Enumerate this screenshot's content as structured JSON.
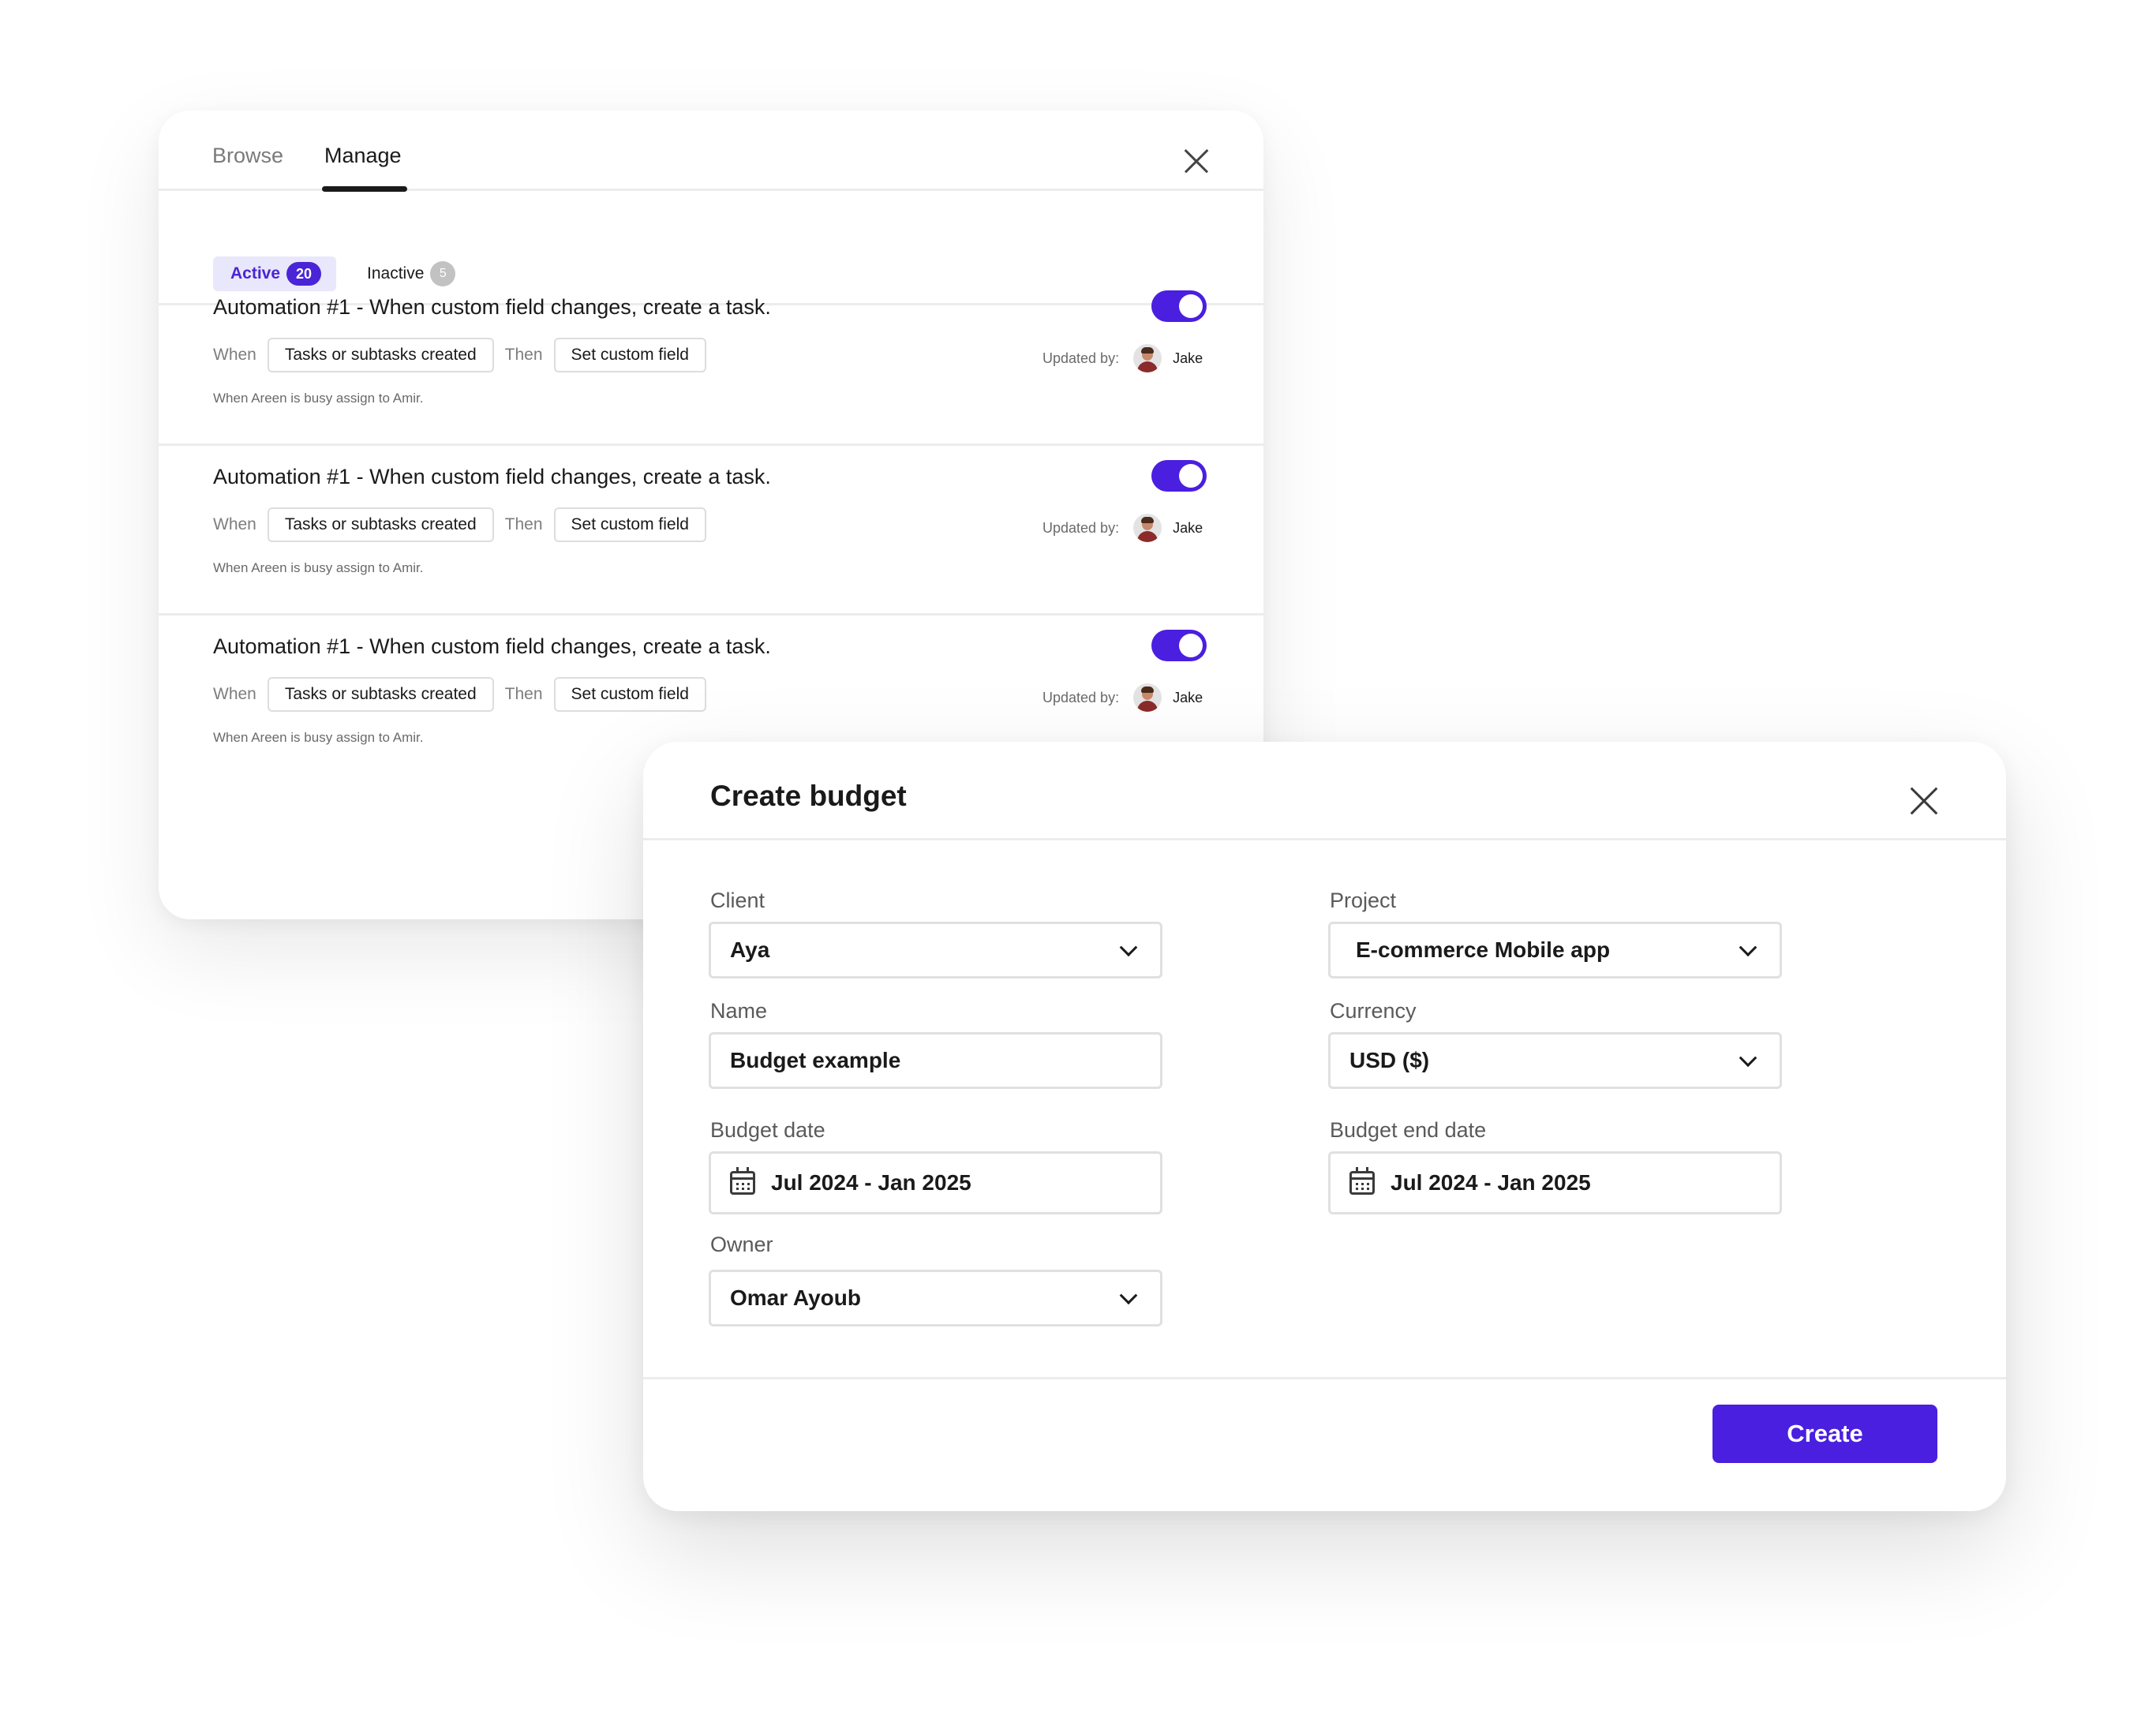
{
  "automations": {
    "tabs": [
      {
        "label": "Browse"
      },
      {
        "label": "Manage"
      }
    ],
    "filters": {
      "active_label": "Active",
      "active_count": "20",
      "inactive_label": "Inactive",
      "inactive_count": "5"
    },
    "items": [
      {
        "title": "Automation #1 - When custom field changes, create a task.",
        "enabled": true,
        "when_word": "When",
        "trigger": "Tasks or subtasks created",
        "then_word": "Then",
        "action": "Set custom field",
        "updated_by_label": "Updated by:",
        "updated_by_name": "Jake",
        "note": "When Areen is busy assign to Amir."
      },
      {
        "title": "Automation #1 - When custom field changes, create a task.",
        "enabled": true,
        "when_word": "When",
        "trigger": "Tasks or subtasks created",
        "then_word": "Then",
        "action": "Set custom field",
        "updated_by_label": "Updated by:",
        "updated_by_name": "Jake",
        "note": "When Areen is busy assign to Amir."
      },
      {
        "title": "Automation #1 - When custom field changes, create a task.",
        "enabled": true,
        "when_word": "When",
        "trigger": "Tasks or subtasks created",
        "then_word": "Then",
        "action": "Set custom field",
        "updated_by_label": "Updated by:",
        "updated_by_name": "Jake",
        "note": "When Areen is busy assign to Amir."
      }
    ]
  },
  "budget": {
    "title": "Create budget",
    "fields": {
      "client": {
        "label": "Client",
        "value": "Aya"
      },
      "project": {
        "label": "Project",
        "value": "E-commerce Mobile app"
      },
      "name": {
        "label": "Name",
        "value": "Budget example"
      },
      "currency": {
        "label": "Currency",
        "value": "USD ($)"
      },
      "budget_date": {
        "label": "Budget date",
        "value": "Jul 2024 - Jan 2025"
      },
      "budget_end_date": {
        "label": "Budget end date",
        "value": "Jul 2024 - Jan 2025"
      },
      "owner": {
        "label": "Owner",
        "value": "Omar Ayoub"
      }
    },
    "create_label": "Create"
  },
  "colors": {
    "accent": "#4a1fe0",
    "accent_soft": "#e9e7fb",
    "border": "#e0e0e0"
  },
  "icons": {
    "close": "close-icon",
    "chevron": "chevron-down-icon",
    "calendar": "calendar-icon",
    "avatar": "avatar"
  }
}
